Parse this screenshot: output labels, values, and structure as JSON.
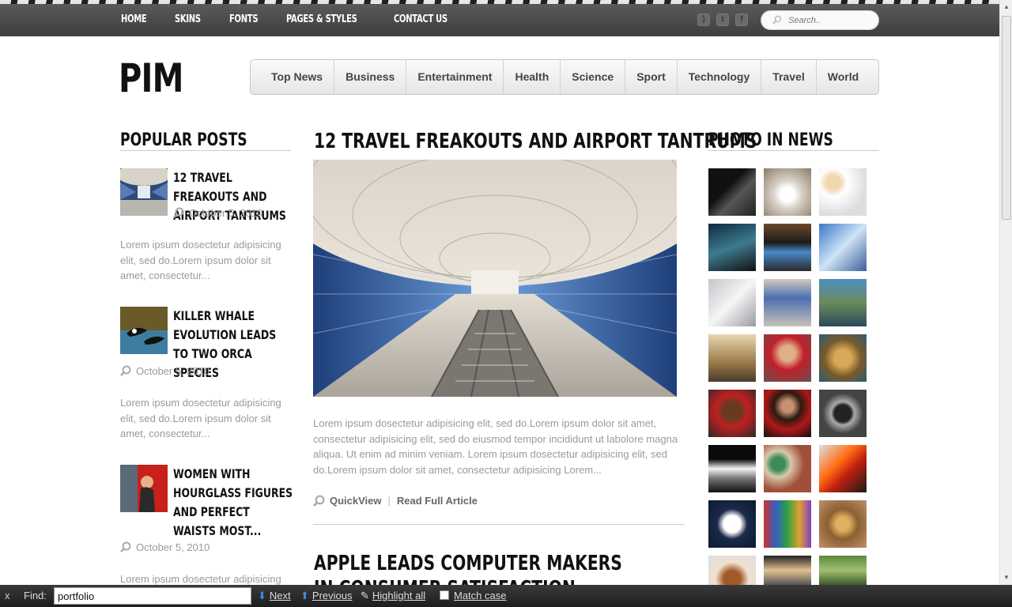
{
  "top_nav": [
    "HOME",
    "SKINS",
    "FONTS",
    "PAGES & STYLES",
    "CONTACT US"
  ],
  "social_icons": [
    "rss-icon",
    "twitter-icon",
    "facebook-icon"
  ],
  "search": {
    "placeholder": "Search.."
  },
  "logo": "PIM",
  "categories": [
    "Top News",
    "Business",
    "Entertainment",
    "Health",
    "Science",
    "Sport",
    "Technology",
    "Travel",
    "World"
  ],
  "left": {
    "heading": "POPULAR POSTS",
    "posts": [
      {
        "title": "12 TRAVEL FREAKOUTS AND AIRPORT TANTRUMS",
        "date": "October 5, 2010",
        "excerpt": "Lorem ipsum dosectetur adipisicing elit, sed do.Lorem ipsum dolor sit amet, consectetur..."
      },
      {
        "title": "KILLER WHALE EVOLUTION LEADS TO TWO ORCA SPECIES",
        "date": "October 5, 2010",
        "excerpt": "Lorem ipsum dosectetur adipisicing elit, sed do.Lorem ipsum dolor sit amet, consectetur..."
      },
      {
        "title": "WOMEN WITH HOURGLASS FIGURES AND PERFECT WAISTS MOST...",
        "date": "October 5, 2010",
        "excerpt": "Lorem ipsum dosectetur adipisicing"
      }
    ]
  },
  "center": {
    "article1_title": "12 TRAVEL FREAKOUTS AND AIRPORT TANTRUMS",
    "article1_text": "Lorem ipsum dosectetur adipisicing elit, sed do.Lorem ipsum dolor sit amet, consectetur adipisicing elit, sed do eiusmod tempor incididunt ut labolore magna aliqua. Ut enim ad minim veniam. Lorem ipsum dosectetur adipisicing elit, sed do.Lorem ipsum dolor sit amet, consectetur adipisicing Lorem...",
    "quickview": "QuickView",
    "read_full": "Read Full Article",
    "separator": "|",
    "article2_title": "APPLE LEADS COMPUTER MAKERS IN CONSUMER SATISFACTION"
  },
  "right": {
    "heading": "PHOTO IN NEWS"
  },
  "findbar": {
    "close": "x",
    "label": "Find:",
    "value": "portfolio",
    "next": "Next",
    "previous": "Previous",
    "highlight": "Highlight all",
    "match_case": "Match case"
  }
}
